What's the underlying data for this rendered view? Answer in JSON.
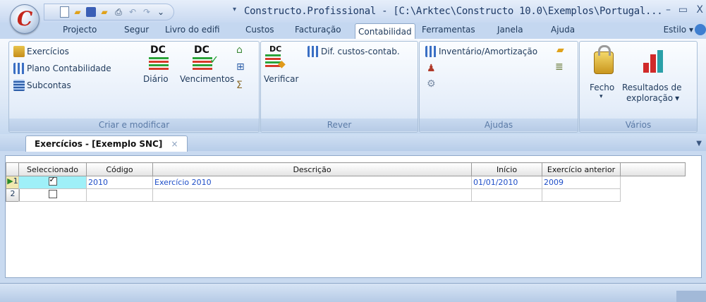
{
  "window": {
    "title": "Constructo.Profissional - [C:\\Arktec\\Constructo 10.0\\Exemplos\\Portugal...",
    "minimize": "–",
    "maximize": "▭",
    "close": "X"
  },
  "app_orb": {
    "letter": "C"
  },
  "qat": {
    "dropdown": "▾"
  },
  "tabs": [
    "Projecto",
    "Segur",
    "Livro do edifi",
    "Custos",
    "Facturação",
    "Contabilidad",
    "Ferramentas",
    "Janela",
    "Ajuda"
  ],
  "active_tab_index": 5,
  "style_menu": "Estilo",
  "ribbon": {
    "groups": [
      {
        "label": "Criar e modificar",
        "items": {
          "exercicios": "Exercícios",
          "plano": "Plano Contabilidade",
          "subcontas": "Subcontas",
          "diario": "Diário",
          "vencimentos": "Vencimentos",
          "dc1": "DC",
          "dc2": "DC"
        }
      },
      {
        "label": "Rever",
        "items": {
          "verificar": "Verificar",
          "dif": "Dif. custos-contab.",
          "dc": "DC"
        }
      },
      {
        "label": "Ajudas",
        "items": {
          "inventario": "Inventário/Amortização"
        }
      },
      {
        "label": "Vários",
        "items": {
          "fecho": "Fecho",
          "resultados": "Resultados de",
          "resultados2": "exploração"
        }
      }
    ]
  },
  "document_tab": {
    "title": "Exercícios - [Exemplo SNC]",
    "close": "×"
  },
  "grid": {
    "columns": [
      "Seleccionado",
      "Código",
      "Descrição",
      "Início",
      "Exercício anterior"
    ],
    "rows": [
      {
        "num": "1",
        "selected": true,
        "codigo": "2010",
        "descricao": "Exercício 2010",
        "inicio": "01/01/2010",
        "anterior": "2009"
      },
      {
        "num": "2",
        "selected": false,
        "codigo": "",
        "descricao": "",
        "inicio": "",
        "anterior": ""
      }
    ]
  },
  "colors": {
    "accent": "#1f4fc8",
    "selection": "#9ff0f8",
    "ribbon_bg": "#dbe7f6"
  }
}
